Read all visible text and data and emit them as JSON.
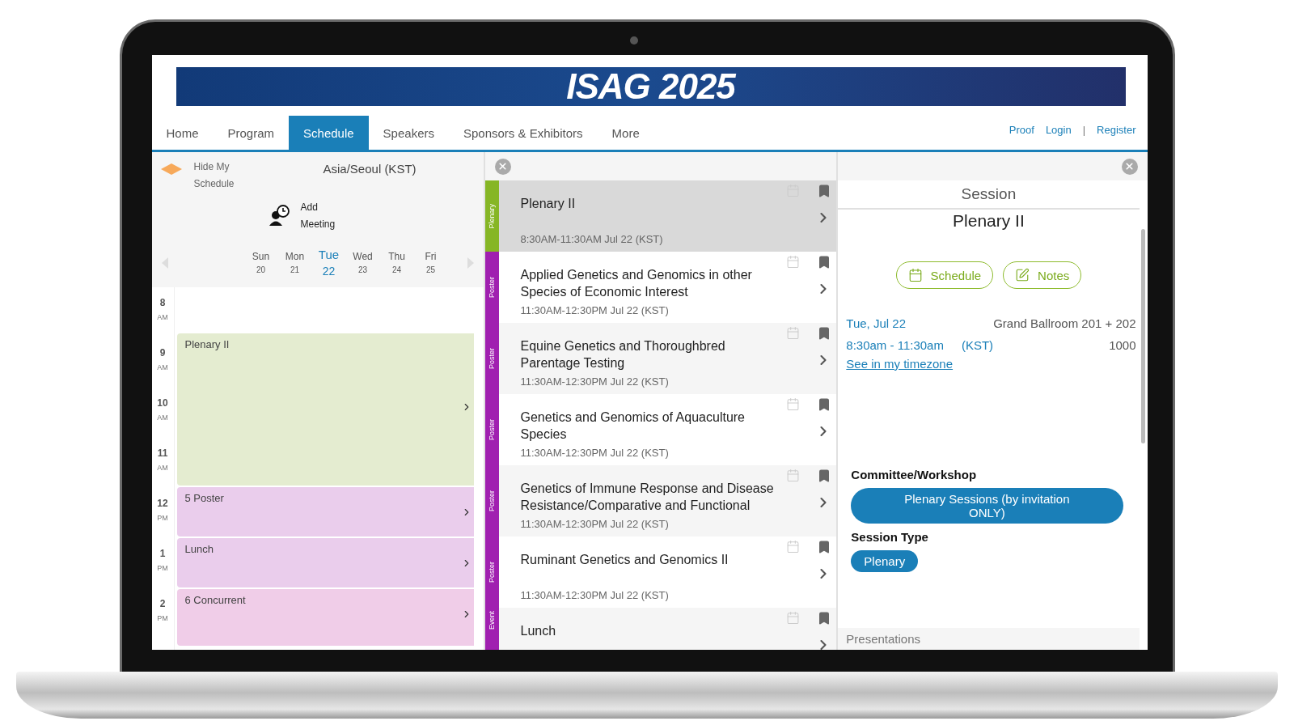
{
  "banner": {
    "title": "ISAG 2025"
  },
  "nav": {
    "tabs": [
      {
        "label": "Home",
        "selected": false
      },
      {
        "label": "Program",
        "selected": false
      },
      {
        "label": "Schedule",
        "selected": true
      },
      {
        "label": "Speakers",
        "selected": false
      },
      {
        "label": "Sponsors & Exhibitors",
        "selected": false
      },
      {
        "label": "More",
        "selected": false
      }
    ],
    "links": [
      "Proof",
      "Login",
      "Register"
    ],
    "separator": "|"
  },
  "calendar": {
    "hide_label": "Hide My Schedule",
    "timezone": "Asia/Seoul (KST)",
    "add_meeting": "Add Meeting",
    "days": [
      {
        "name": "Sun",
        "date": "20",
        "selected": false
      },
      {
        "name": "Mon",
        "date": "21",
        "selected": false
      },
      {
        "name": "Tue",
        "date": "22",
        "selected": true
      },
      {
        "name": "Wed",
        "date": "23",
        "selected": false
      },
      {
        "name": "Thu",
        "date": "24",
        "selected": false
      },
      {
        "name": "Fri",
        "date": "25",
        "selected": false
      }
    ],
    "hours": [
      {
        "hour": "8",
        "period": "AM"
      },
      {
        "hour": "9",
        "period": "AM"
      },
      {
        "hour": "10",
        "period": "AM"
      },
      {
        "hour": "11",
        "period": "AM"
      },
      {
        "hour": "12",
        "period": "PM"
      },
      {
        "hour": "1",
        "period": "PM"
      },
      {
        "hour": "2",
        "period": "PM"
      }
    ],
    "events": [
      {
        "title": "Plenary II",
        "kind": "long",
        "color": "#e4ecd0"
      },
      {
        "title": "5 Poster",
        "kind": "short",
        "color": "#eacdec"
      },
      {
        "title": "Lunch",
        "kind": "short",
        "color": "#eacdec"
      },
      {
        "title": "6 Concurrent",
        "kind": "open",
        "color": "#f0cde8"
      }
    ]
  },
  "sessions": [
    {
      "track": "Plenary",
      "color": "#86b625",
      "title": "Plenary II",
      "time": "8:30AM-11:30AM Jul 22 (KST)",
      "selected": true
    },
    {
      "track": "Poster",
      "color": "#a020b0",
      "title": "Applied Genetics and Genomics in other Species of Economic Interest",
      "time": "11:30AM-12:30PM Jul 22 (KST)",
      "selected": false
    },
    {
      "track": "Poster",
      "color": "#a020b0",
      "title": "Equine Genetics and Thoroughbred Parentage Testing",
      "time": "11:30AM-12:30PM Jul 22 (KST)",
      "selected": false
    },
    {
      "track": "Poster",
      "color": "#a020b0",
      "title": "Genetics and Genomics of Aquaculture Species",
      "time": "11:30AM-12:30PM Jul 22 (KST)",
      "selected": false
    },
    {
      "track": "Poster",
      "color": "#a020b0",
      "title": "Genetics of Immune Response and Disease Resistance/Comparative and Functional",
      "time": "11:30AM-12:30PM Jul 22 (KST)",
      "selected": false
    },
    {
      "track": "Poster",
      "color": "#a020b0",
      "title": "Ruminant Genetics and Genomics II",
      "time": "11:30AM-12:30PM Jul 22 (KST)",
      "selected": false
    },
    {
      "track": "Event",
      "color": "#a020b0",
      "title": "Lunch",
      "selected": false
    }
  ],
  "details": {
    "heading": "Session",
    "title": "Plenary II",
    "buttons": [
      {
        "label": "Schedule",
        "kind": "schedule"
      },
      {
        "label": "Notes",
        "kind": "notes"
      }
    ],
    "date": "Tue, Jul 22",
    "room": "Grand Ballroom 201 + 202",
    "time": "8:30am - 11:30am",
    "timezone": "(KST)",
    "capacity": "1000",
    "link": "See in my timezone",
    "groups": [
      {
        "label": "Committee/Workshop",
        "tags": [
          "Plenary Sessions (by invitation ONLY)"
        ]
      },
      {
        "label": "Session Type",
        "tags": [
          "Plenary"
        ]
      }
    ],
    "presentations": "Presentations"
  }
}
